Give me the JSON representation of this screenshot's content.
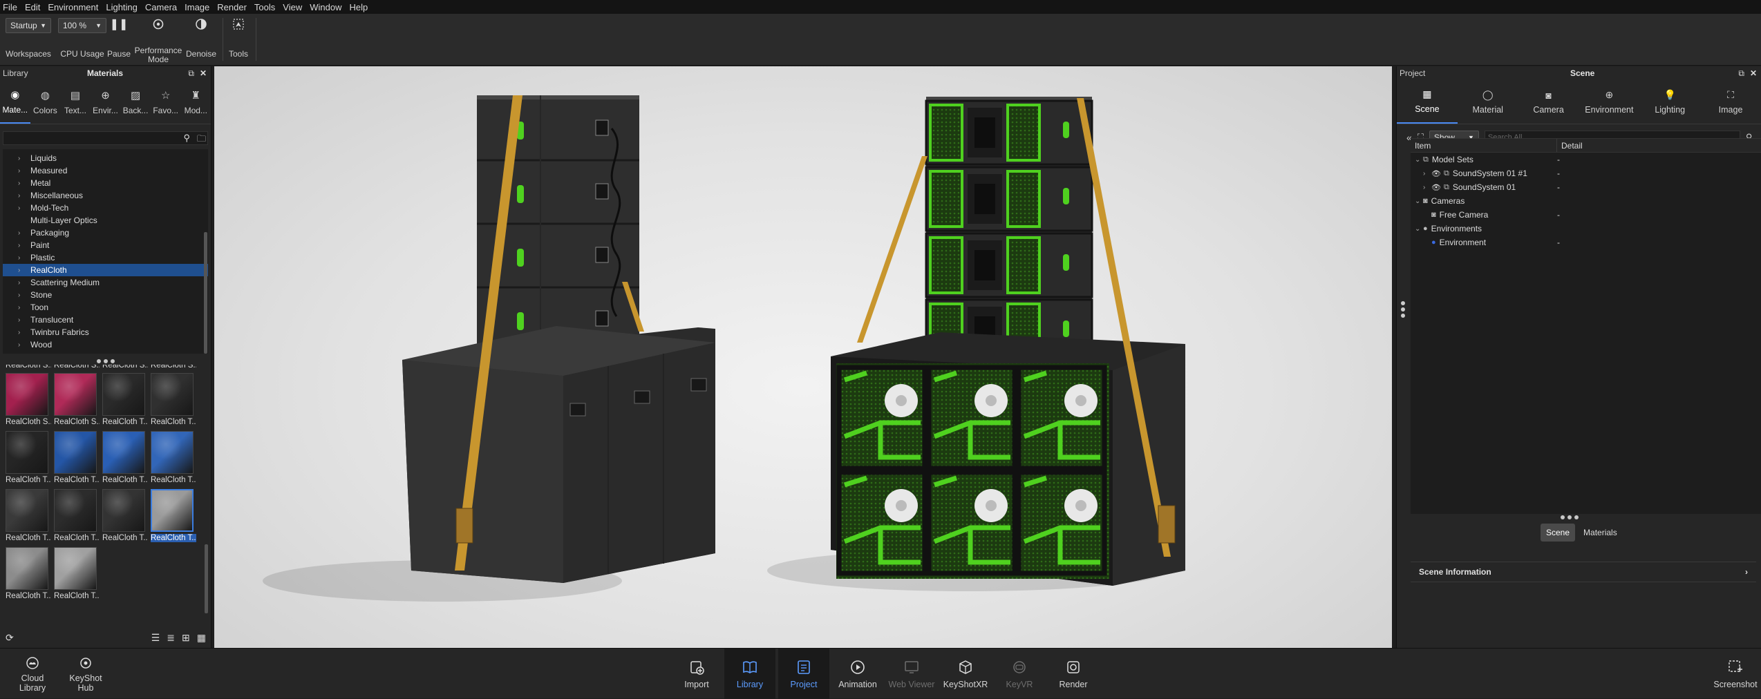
{
  "menu": [
    "File",
    "Edit",
    "Environment",
    "Lighting",
    "Camera",
    "Image",
    "Render",
    "Tools",
    "View",
    "Window",
    "Help"
  ],
  "toolbar": {
    "workspace_value": "Startup",
    "workspaces_label": "Workspaces",
    "cpu_value": "100 %",
    "cpu_label": "CPU Usage",
    "pause_label": "Pause",
    "performance_label_1": "Performance",
    "performance_label_2": "Mode",
    "denoise_label": "Denoise",
    "tools_label": "Tools"
  },
  "library": {
    "panel_label": "Library",
    "title": "Materials",
    "tabs": [
      {
        "label": "Mate..."
      },
      {
        "label": "Colors"
      },
      {
        "label": "Text..."
      },
      {
        "label": "Envir..."
      },
      {
        "label": "Back..."
      },
      {
        "label": "Favo..."
      },
      {
        "label": "Mod..."
      }
    ],
    "categories": [
      {
        "label": "Liquids",
        "has_children": true
      },
      {
        "label": "Measured",
        "has_children": true
      },
      {
        "label": "Metal",
        "has_children": true
      },
      {
        "label": "Miscellaneous",
        "has_children": true
      },
      {
        "label": "Mold-Tech",
        "has_children": true
      },
      {
        "label": "Multi-Layer Optics",
        "has_children": false
      },
      {
        "label": "Packaging",
        "has_children": true
      },
      {
        "label": "Paint",
        "has_children": true
      },
      {
        "label": "Plastic",
        "has_children": true
      },
      {
        "label": "RealCloth",
        "has_children": true,
        "selected": true
      },
      {
        "label": "Scattering Medium",
        "has_children": true
      },
      {
        "label": "Stone",
        "has_children": true
      },
      {
        "label": "Toon",
        "has_children": true
      },
      {
        "label": "Translucent",
        "has_children": true
      },
      {
        "label": "Twinbru Fabrics",
        "has_children": true
      },
      {
        "label": "Wood",
        "has_children": true
      }
    ],
    "thumbnails": [
      {
        "label": "RealCloth S...",
        "color": "#4f8a3a"
      },
      {
        "label": "RealCloth S...",
        "color": "#6a9a4a"
      },
      {
        "label": "RealCloth S...",
        "color": "#8a8a8a"
      },
      {
        "label": "RealCloth S...",
        "color": "#7a6a5a"
      },
      {
        "label": "RealCloth S...",
        "color": "#a3204e"
      },
      {
        "label": "RealCloth S...",
        "color": "#b02a58"
      },
      {
        "label": "RealCloth T...",
        "color": "#2a2a2a"
      },
      {
        "label": "RealCloth T...",
        "color": "#303030"
      },
      {
        "label": "RealCloth T...",
        "color": "#252525"
      },
      {
        "label": "RealCloth T...",
        "color": "#2456a6"
      },
      {
        "label": "RealCloth T...",
        "color": "#2a5fb4"
      },
      {
        "label": "RealCloth T...",
        "color": "#3266b8"
      },
      {
        "label": "RealCloth T...",
        "color": "#3a3a3a"
      },
      {
        "label": "RealCloth T...",
        "color": "#2c2c2c"
      },
      {
        "label": "RealCloth T...",
        "color": "#333333"
      },
      {
        "label": "RealCloth T...",
        "color": "#9a9a9a",
        "selected": true
      },
      {
        "label": "RealCloth T...",
        "color": "#8c8c8c"
      },
      {
        "label": "RealCloth T...",
        "color": "#a0a0a0"
      }
    ]
  },
  "project": {
    "panel_label": "Project",
    "title": "Scene",
    "tabs": [
      {
        "label": "Scene"
      },
      {
        "label": "Material"
      },
      {
        "label": "Camera"
      },
      {
        "label": "Environment"
      },
      {
        "label": "Lighting"
      },
      {
        "label": "Image"
      }
    ],
    "show_value": "Show",
    "search_placeholder": "Search All",
    "col_item": "Item",
    "col_detail": "Detail",
    "tree": [
      {
        "label": "Model Sets",
        "detail": "-",
        "level": 0,
        "icon": "model-sets"
      },
      {
        "label": "SoundSystem 01 #1",
        "detail": "-",
        "level": 1,
        "icon": "model"
      },
      {
        "label": "SoundSystem 01",
        "detail": "-",
        "level": 1,
        "icon": "model"
      },
      {
        "label": "Cameras",
        "detail": "",
        "level": 0,
        "icon": "camera"
      },
      {
        "label": "Free Camera",
        "detail": "-",
        "level": 1,
        "icon": "camera"
      },
      {
        "label": "Environments",
        "detail": "",
        "level": 0,
        "icon": "environment"
      },
      {
        "label": "Environment",
        "detail": "-",
        "level": 1,
        "icon": "environment"
      }
    ],
    "btn_scene": "Scene",
    "btn_materials": "Materials",
    "scene_info": "Scene Information"
  },
  "bottom": {
    "cloud_1": "Cloud",
    "cloud_2": "Library",
    "hub_1": "KeyShot",
    "hub_2": "Hub",
    "import": "Import",
    "library": "Library",
    "project": "Project",
    "animation": "Animation",
    "webviewer": "Web Viewer",
    "keyshotxr": "KeyShotXR",
    "keyvr": "KeyVR",
    "render": "Render",
    "screenshot": "Screenshot"
  },
  "colors": {
    "accent": "#4a8af4",
    "speaker_green": "#4fd11f",
    "strap": "#c8962e"
  }
}
